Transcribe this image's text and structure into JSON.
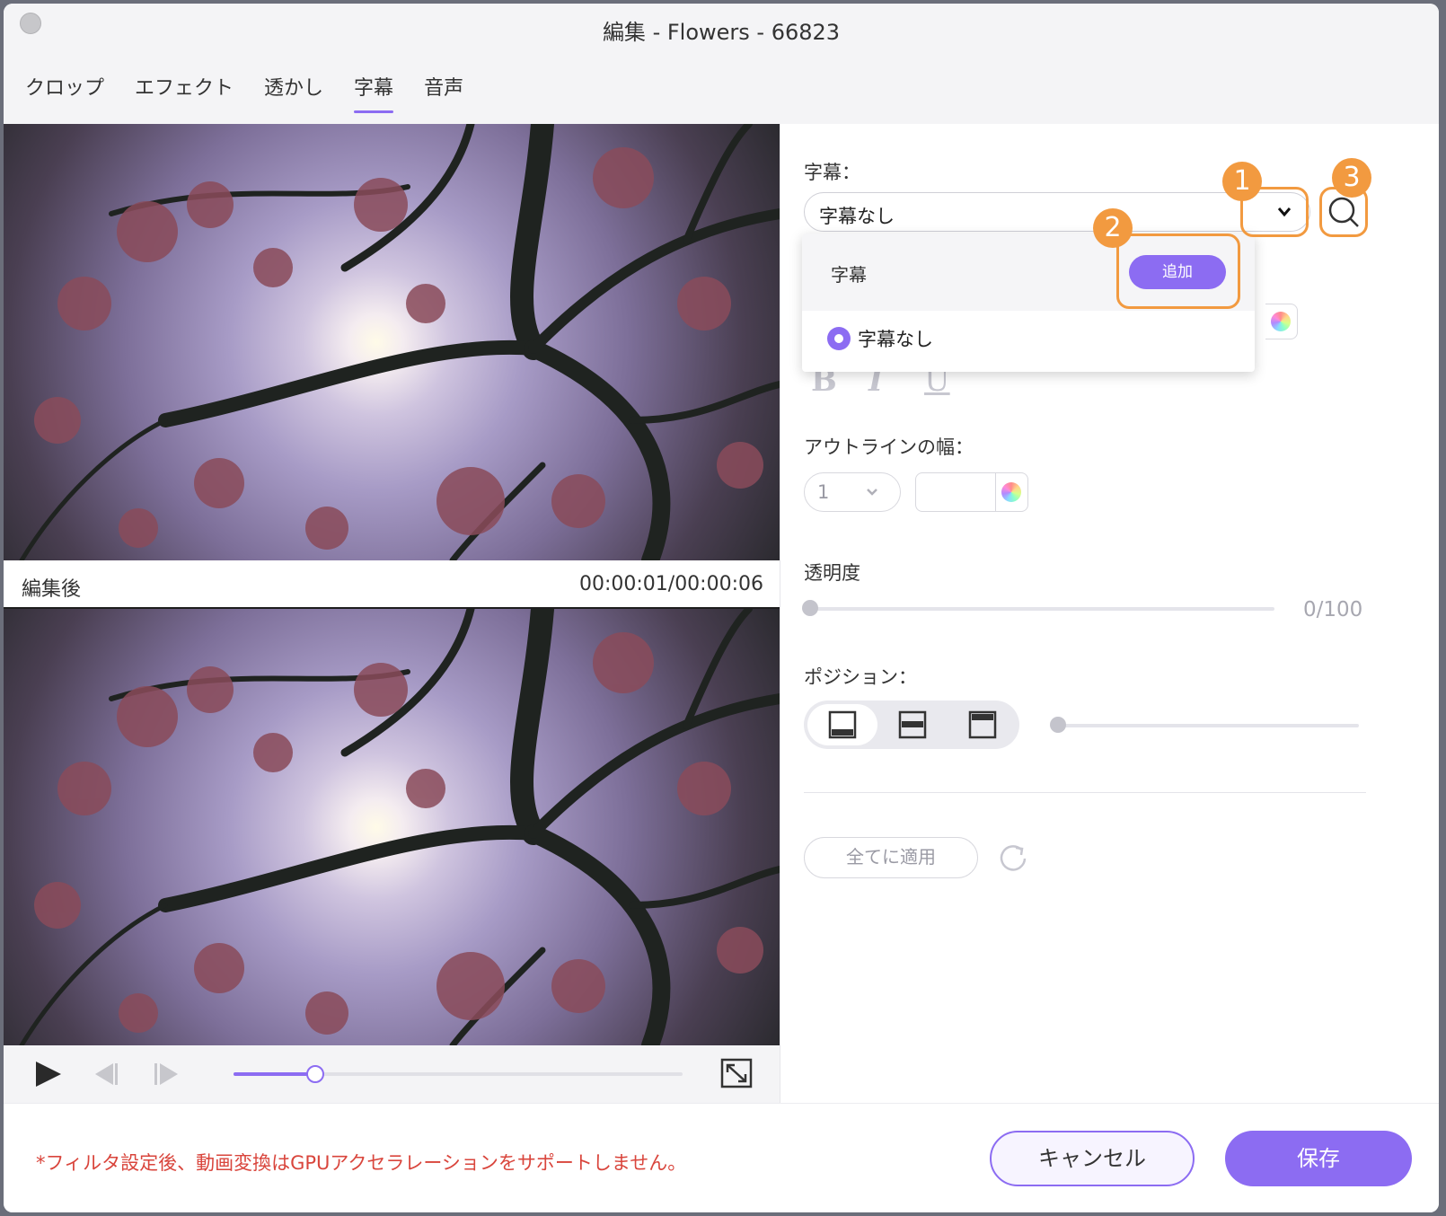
{
  "window": {
    "title": "編集 - Flowers - 66823"
  },
  "tabs": [
    {
      "label": "クロップ"
    },
    {
      "label": "エフェクト"
    },
    {
      "label": "透かし"
    },
    {
      "label": "字幕",
      "active": true
    },
    {
      "label": "音声"
    }
  ],
  "preview": {
    "after_label": "編集後",
    "timecode": "00:00:01/00:00:06",
    "progress": 0.18
  },
  "subtitle": {
    "label": "字幕：",
    "selected": "字幕なし",
    "dropdown": {
      "header": "字幕",
      "add_button": "追加",
      "options": [
        "字幕なし"
      ]
    },
    "callouts": [
      "1",
      "2",
      "3"
    ]
  },
  "font_style": {
    "bold": "B",
    "italic": "I",
    "underline": "U"
  },
  "outline": {
    "label": "アウトラインの幅：",
    "width_value": "1"
  },
  "opacity": {
    "label": "透明度",
    "value_text": "0/100",
    "value": 0
  },
  "position": {
    "label": "ポジション：",
    "selected": "bottom"
  },
  "apply_all": "全てに適用",
  "footer": {
    "note": "*フィルタ設定後、動画変換はGPUアクセラレーションをサポートしません。",
    "cancel": "キャンセル",
    "save": "保存"
  },
  "colors": {
    "accent": "#8c6cf2",
    "callout": "#f29a40",
    "warning": "#d9453c"
  },
  "icons": [
    "chevron-down-icon",
    "search-icon",
    "play-icon",
    "prev-frame-icon",
    "next-frame-icon",
    "fullscreen-icon",
    "refresh-icon",
    "color-picker-icon"
  ]
}
